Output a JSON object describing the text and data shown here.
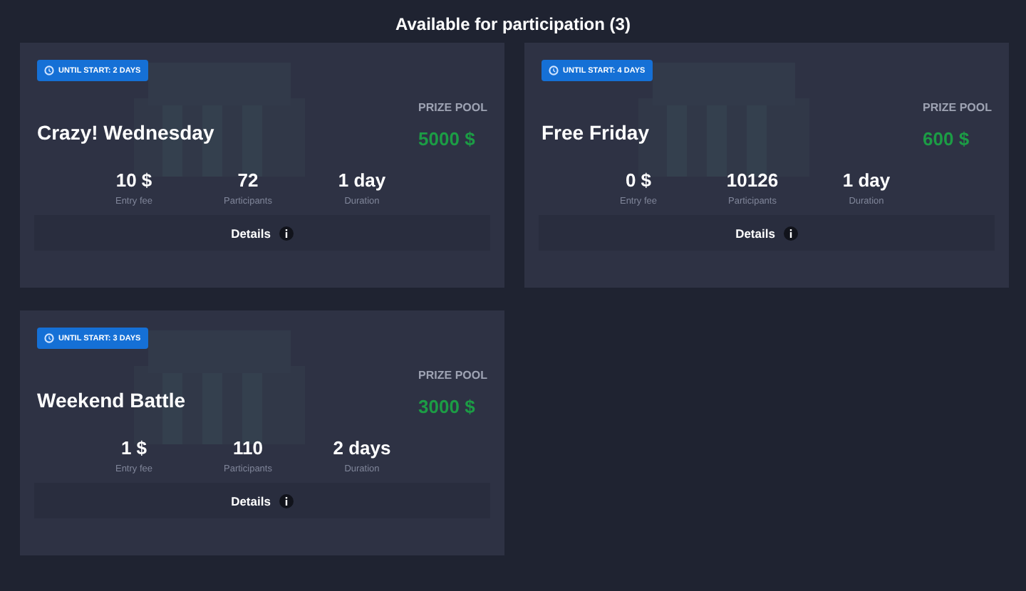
{
  "header": {
    "title": "Available for participation (3)"
  },
  "tournaments": [
    {
      "badge": "UNTIL START: 2 DAYS",
      "name": "Crazy! Wednesday",
      "prize_label": "PRIZE POOL",
      "prize": "5000 $",
      "stats": [
        {
          "value": "10 $",
          "label": "Entry fee"
        },
        {
          "value": "72",
          "label": "Participants"
        },
        {
          "value": "1 day",
          "label": "Duration"
        }
      ],
      "details": "Details"
    },
    {
      "badge": "UNTIL START: 4 DAYS",
      "name": "Free Friday",
      "prize_label": "PRIZE POOL",
      "prize": "600 $",
      "stats": [
        {
          "value": "0 $",
          "label": "Entry fee"
        },
        {
          "value": "10126",
          "label": "Participants"
        },
        {
          "value": "1 day",
          "label": "Duration"
        }
      ],
      "details": "Details"
    },
    {
      "badge": "UNTIL START: 3 DAYS",
      "name": "Weekend Battle",
      "prize_label": "PRIZE POOL",
      "prize": "3000 $",
      "stats": [
        {
          "value": "1 $",
          "label": "Entry fee"
        },
        {
          "value": "110",
          "label": "Participants"
        },
        {
          "value": "2 days",
          "label": "Duration"
        }
      ],
      "details": "Details"
    }
  ]
}
